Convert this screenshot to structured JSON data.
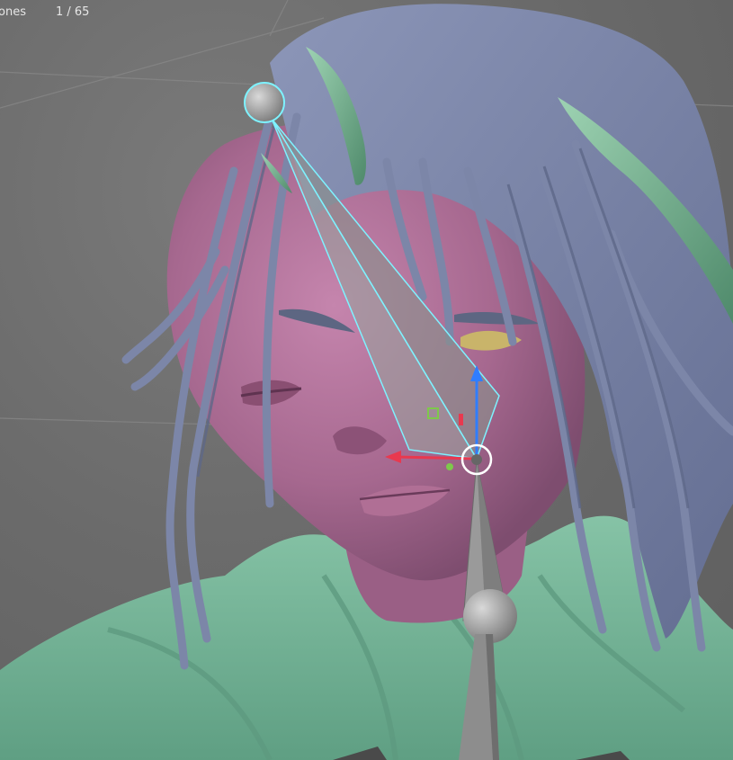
{
  "stats": {
    "label": "ones",
    "value": "1 / 65"
  },
  "colors": {
    "viewport_bg": "#6b6b6b",
    "skin": "#a9688f",
    "hair": "#7c86a8",
    "horn": "#6aa283",
    "cloth": "#79b69a",
    "bone_selected_outline": "#7ef2ff",
    "bone_fill": "#8a8f8c",
    "gizmo_x": "#e8394f",
    "gizmo_z": "#2f7dff",
    "gizmo_y": "#7ec84b"
  }
}
